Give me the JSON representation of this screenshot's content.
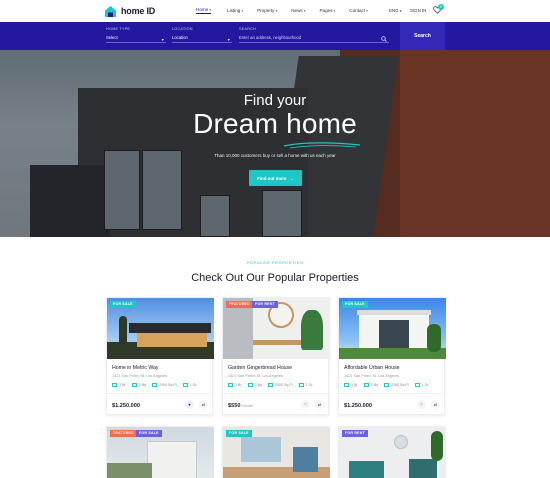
{
  "header": {
    "logo": "home ID",
    "nav": [
      {
        "label": "Home",
        "active": true
      },
      {
        "label": "Listing",
        "active": false
      },
      {
        "label": "Property",
        "active": false
      },
      {
        "label": "News",
        "active": false
      },
      {
        "label": "Pages",
        "active": false
      },
      {
        "label": "Contact",
        "active": false
      }
    ],
    "lang": "ENG",
    "signin": "SIGN IN",
    "favorites_count": "0"
  },
  "searchbar": {
    "home_type_label": "HOME TYPE",
    "home_type_value": "Select",
    "location_label": "LOCATION",
    "location_value": "Location",
    "search_label": "SEARCH",
    "search_placeholder": "Enter an address, neighbourhood",
    "button": "Search"
  },
  "hero": {
    "line1": "Find your",
    "line2": "Dream home",
    "subtitle": "Than 10,000 customers buy or sell a home with us each year",
    "button": "Find out more"
  },
  "section": {
    "eyebrow": "POPULAR PROPERTIES",
    "title": "Check Out Our Popular Properties"
  },
  "cards": [
    {
      "tags": [
        "FOR SALE"
      ],
      "title": "Home in Metric Way",
      "address": "1421 San Pedro St, Los Angeles",
      "beds": "3 Br",
      "baths": "3 Ba",
      "area": "2300 Sq.Ft",
      "garage": "1 Gr",
      "price": "$1.250.000",
      "unit": ""
    },
    {
      "tags": [
        "FEATURED",
        "FOR RENT"
      ],
      "title": "Garden Gingerbread House",
      "address": "1421 San Pedro St, Los Angeles",
      "beds": "3 Br",
      "baths": "3 Ba",
      "area": "2300 Sq.Ft",
      "garage": "1 Gr",
      "price": "$550",
      "unit": "/month"
    },
    {
      "tags": [
        "FOR SALE"
      ],
      "title": "Affordable Urban House",
      "address": "1421 San Pedro St, Los Angeles",
      "beds": "3 Br",
      "baths": "3 Ba",
      "area": "2300 Sq.Ft",
      "garage": "1 Gr",
      "price": "$1.250.000",
      "unit": ""
    }
  ],
  "cards_row2": [
    {
      "tags": [
        "FEATURED",
        "FOR SALE"
      ]
    },
    {
      "tags": [
        "FOR SALE"
      ]
    },
    {
      "tags": [
        "FOR RENT"
      ]
    }
  ],
  "colors": {
    "brand": "#2418a0",
    "accent": "#1ec6c6",
    "featured": "#f26c4f",
    "rent": "#6c63d9"
  }
}
